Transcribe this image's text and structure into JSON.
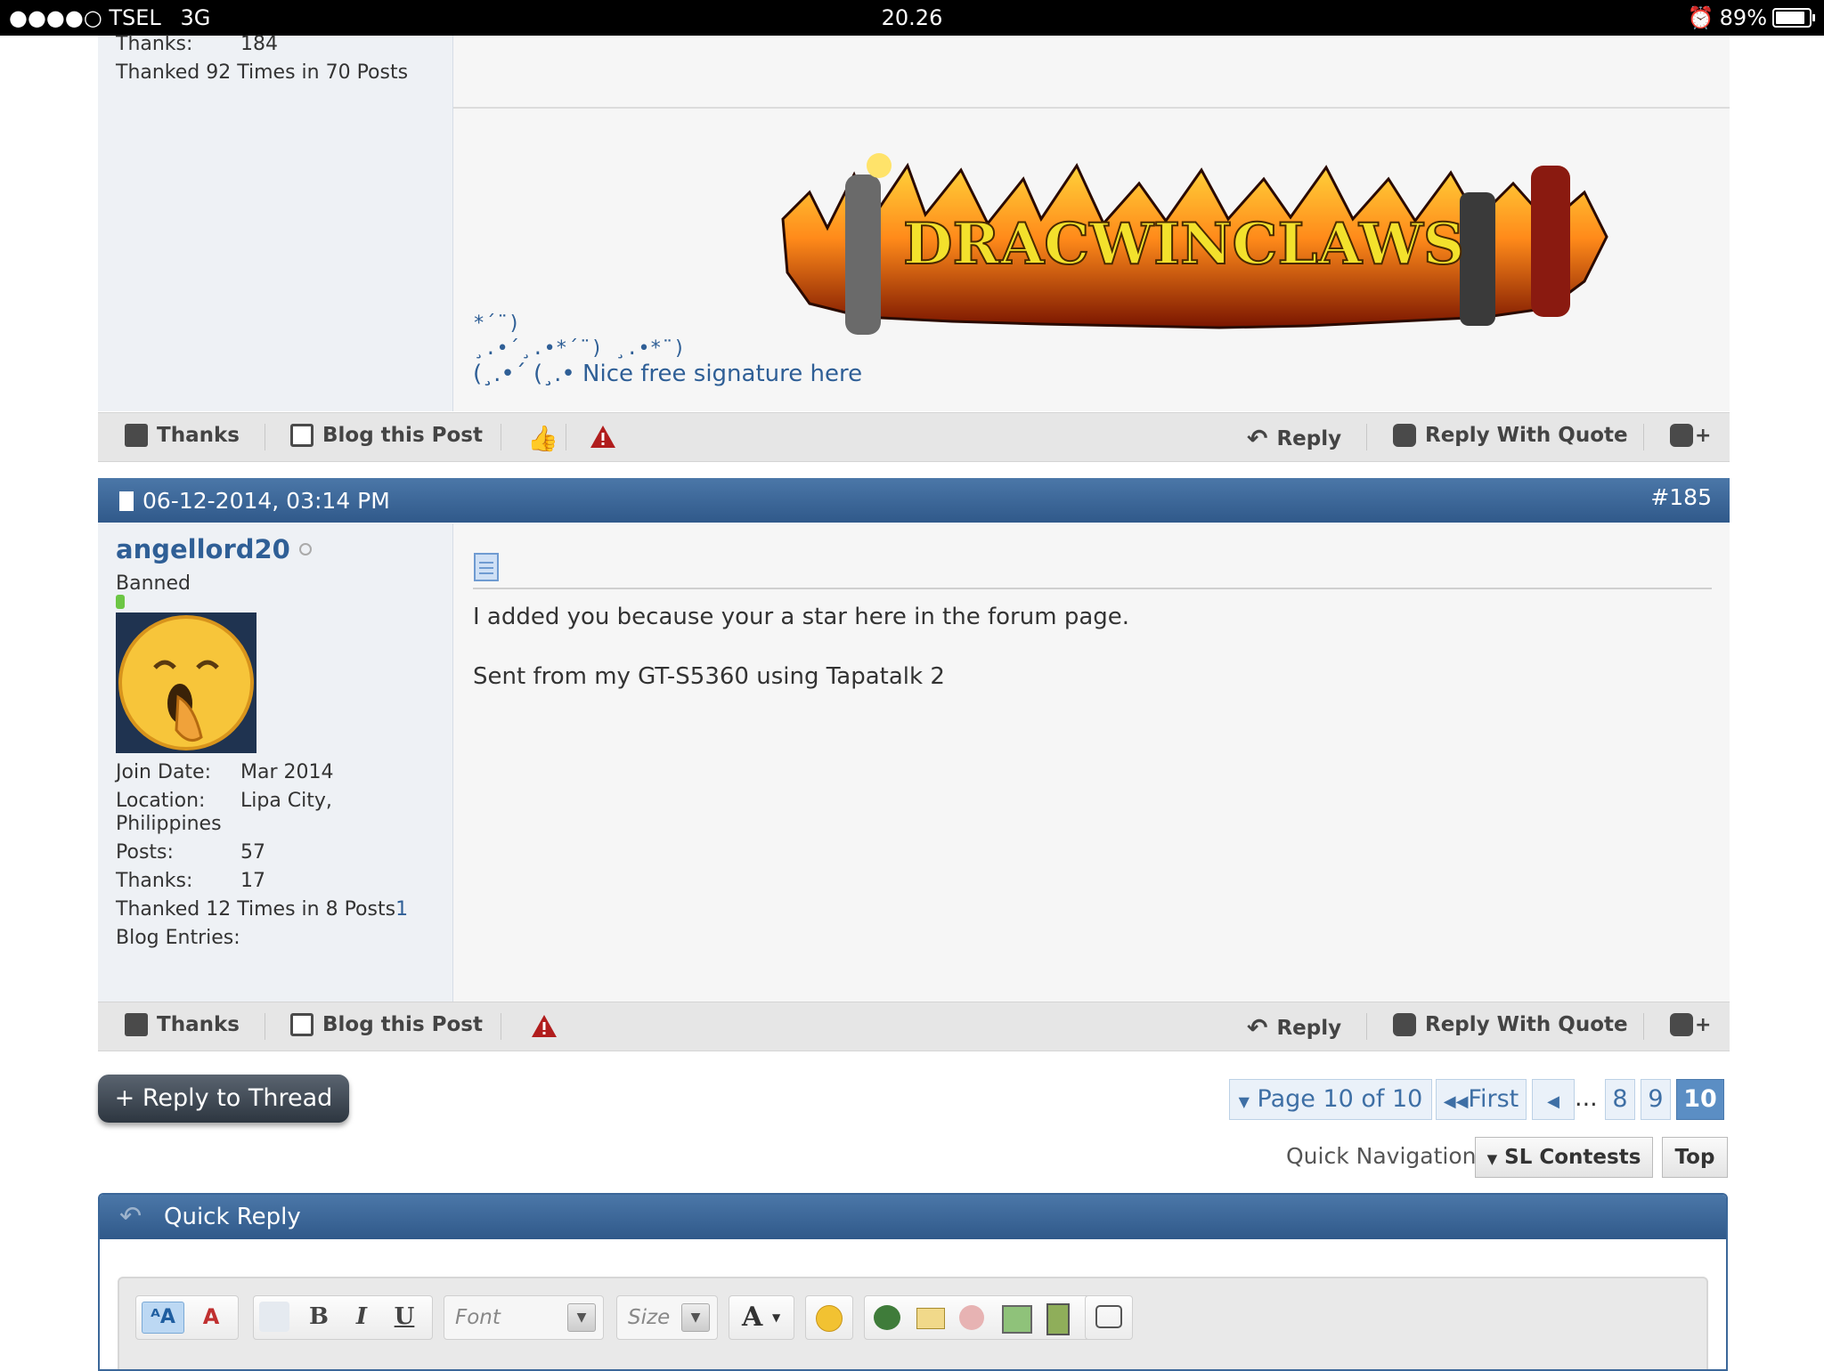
{
  "status_bar": {
    "signal": "●●●●○",
    "carrier": "TSEL",
    "network": "3G",
    "time": "20.26",
    "battery": "89%",
    "battery_level": 0.89
  },
  "post1": {
    "user_stats": [
      {
        "key": "Thanks:",
        "value": "184"
      }
    ],
    "thanked": "Thanked 92 Times in 70 Posts",
    "signature_banner_text": "DRACWINCLAWS",
    "ascii_line1": "*´¨)",
    "ascii_line2": "¸.•´¸.•*´¨) ¸.•*¨)",
    "ascii_line3_prefix": "(¸.•´ (¸.•",
    "signature_link": "Nice free signature here"
  },
  "actions": {
    "thanks": "Thanks",
    "blog": "Blog this Post",
    "reply": "Reply",
    "reply_quote": "Reply With Quote"
  },
  "post2": {
    "date": "06-12-2014, 03:14 PM",
    "post_number": "#185",
    "username": "angellord20",
    "user_title": "Banned",
    "join_key": "Join Date:",
    "join_value": "Mar 2014",
    "location_key": "Location:",
    "location_value": "Lipa City,",
    "location_value_2": "Philippines",
    "posts_key": "Posts:",
    "posts_value": "57",
    "thanks_key": "Thanks:",
    "thanks_value": "17",
    "thanked": "Thanked 12 Times in 8 Posts",
    "thanked_link": "1",
    "blog_entries": "Blog Entries:",
    "message_line1": "I added you because your a star here in the forum page.",
    "message_line2": "Sent from my GT-S5360 using Tapatalk 2"
  },
  "reply_thread_button": "+ Reply to Thread",
  "pagination": {
    "label": "Page 10 of 10",
    "first": "First",
    "ellipsis": "...",
    "pages": [
      "8",
      "9",
      "10"
    ],
    "current": "10"
  },
  "quick_nav": {
    "label": "Quick Navigation",
    "dropdown": "SL Contests",
    "top": "Top"
  },
  "quick_reply": {
    "title": "Quick Reply",
    "font_placeholder": "Font",
    "size_placeholder": "Size",
    "bold": "B",
    "italic": "I",
    "underline": "U",
    "text_color": "A"
  }
}
